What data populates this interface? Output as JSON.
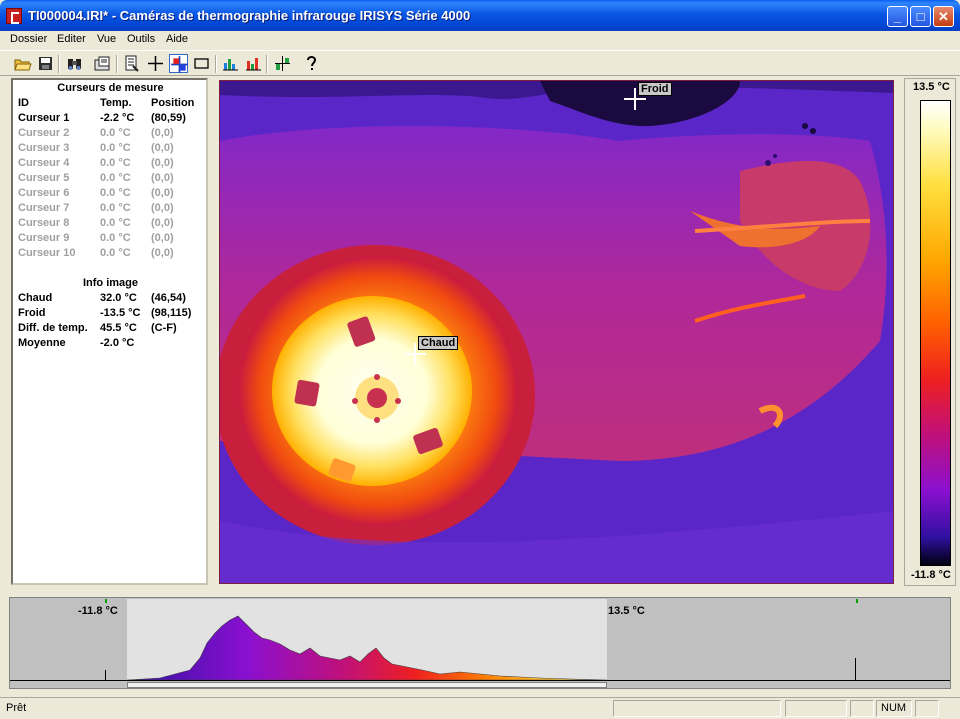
{
  "window": {
    "title": "TI000004.IRI* - Caméras de thermographie infrarouge IRISYS Série 4000",
    "minimize": "_",
    "maximize": "□",
    "close": "✕"
  },
  "menu": [
    "Dossier",
    "Editer",
    "Vue",
    "Outils",
    "Aide"
  ],
  "toolbar": {
    "icons": [
      "open-folder-icon",
      "save-disk-icon",
      "binoculars-icon",
      "camera-settings-icon",
      "report-icon",
      "crosshair-icon",
      "hot-cold-cursor-icon",
      "rectangle-icon",
      "bar-chart-icon",
      "histogram-icon",
      "cursor-plus-icon",
      "help-icon"
    ],
    "active": "hot-cold-cursor-icon"
  },
  "cursors_panel": {
    "title": "Curseurs de mesure",
    "headers": [
      "ID",
      "Temp.",
      "Position"
    ],
    "rows": [
      {
        "id": "Curseur 1",
        "temp": "-2.2 °C",
        "pos": "(80,59)",
        "active": true
      },
      {
        "id": "Curseur 2",
        "temp": "0.0 °C",
        "pos": "(0,0)",
        "active": false
      },
      {
        "id": "Curseur 3",
        "temp": "0.0 °C",
        "pos": "(0,0)",
        "active": false
      },
      {
        "id": "Curseur 4",
        "temp": "0.0 °C",
        "pos": "(0,0)",
        "active": false
      },
      {
        "id": "Curseur 5",
        "temp": "0.0 °C",
        "pos": "(0,0)",
        "active": false
      },
      {
        "id": "Curseur 6",
        "temp": "0.0 °C",
        "pos": "(0,0)",
        "active": false
      },
      {
        "id": "Curseur 7",
        "temp": "0.0 °C",
        "pos": "(0,0)",
        "active": false
      },
      {
        "id": "Curseur 8",
        "temp": "0.0 °C",
        "pos": "(0,0)",
        "active": false
      },
      {
        "id": "Curseur 9",
        "temp": "0.0 °C",
        "pos": "(0,0)",
        "active": false
      },
      {
        "id": "Curseur 10",
        "temp": "0.0 °C",
        "pos": "(0,0)",
        "active": false
      }
    ],
    "info_title": "Info image",
    "info_rows": [
      {
        "label": "Chaud",
        "value": "32.0 °C",
        "extra": "(46,54)"
      },
      {
        "label": "Froid",
        "value": "-13.5 °C",
        "extra": "(98,115)"
      },
      {
        "label": "Diff. de temp.",
        "value": "45.5 °C",
        "extra": "(C-F)"
      },
      {
        "label": "Moyenne",
        "value": "-2.0 °C",
        "extra": ""
      }
    ]
  },
  "image": {
    "hot_label": "Chaud",
    "cold_label": "Froid"
  },
  "scale": {
    "max": "13.5 °C",
    "min": "-11.8 °C"
  },
  "histogram": {
    "min_label": "-11.8 °C",
    "max_label": "13.5 °C"
  },
  "status": {
    "text": "Prêt",
    "num": "NUM"
  }
}
